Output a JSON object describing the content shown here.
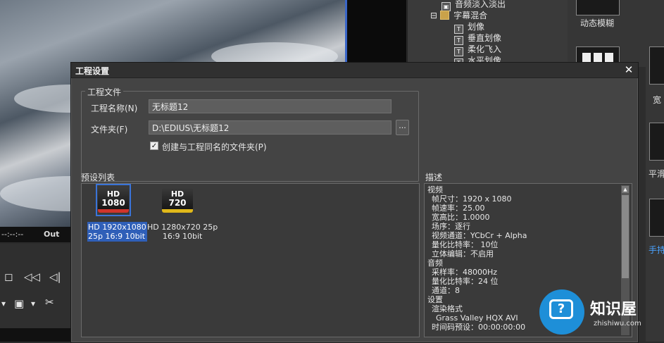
{
  "background": {
    "timecode_text": "--:--:--",
    "out_label": "Out",
    "transport_icons": [
      "stop-icon",
      "rewind-icon",
      "step-back-icon"
    ],
    "toolbar_icons": [
      "save-icon",
      "scissors-icon"
    ]
  },
  "tree": {
    "items": [
      {
        "label": "音频淡入淡出",
        "icon": "effect-icon",
        "level": 1
      },
      {
        "label": "字幕混合",
        "icon": "folder-icon",
        "level": 0
      },
      {
        "label": "划像",
        "icon": "title-icon",
        "level": 2
      },
      {
        "label": "垂直划像",
        "icon": "title-icon",
        "level": 2
      },
      {
        "label": "柔化飞入",
        "icon": "title-icon",
        "level": 2
      },
      {
        "label": "水平划像",
        "icon": "title-icon",
        "level": 2
      }
    ]
  },
  "thumbs": {
    "labels": [
      "动态模糊",
      "宽",
      "平滑",
      "手持"
    ]
  },
  "dialog": {
    "title": "工程设置",
    "close_symbol": "✕",
    "project_group": {
      "legend": "工程文件",
      "name_label": "工程名称(N)",
      "name_value": "无标题12",
      "folder_label": "文件夹(F)",
      "folder_value": "D:\\EDIUS\\无标题12",
      "browse_label": "...",
      "checkbox_label": "创建与工程同名的文件夹(P)",
      "checkbox_checked": true
    },
    "preset_list": {
      "label": "预设列表",
      "presets": [
        {
          "icon_top": "HD",
          "icon_bottom": "1080",
          "line1": "HD 1920x1080",
          "line2": "25p 16:9 10bit",
          "selected": true,
          "accent": "#d0342c"
        },
        {
          "icon_top": "HD",
          "icon_bottom": "720",
          "line1": "HD 1280x720 25p",
          "line2": "16:9 10bit",
          "selected": false,
          "accent": "#e0b81a"
        }
      ]
    },
    "description": {
      "label": "描述",
      "lines": [
        "视频",
        "  帧尺寸：1920 x 1080",
        "  帧速率：25.00",
        "  宽高比：1.0000",
        "  场序：逐行",
        "  视频通道：YCbCr + Alpha",
        "  量化比特率： 10位",
        "  立体编辑：不启用",
        "音频",
        "  采样率：48000Hz",
        "  量化比特率：24 位",
        "  通道：8",
        "设置",
        "  渲染格式",
        "    Grass Valley HQX AVI",
        "  时间码预设：00:00:00:00"
      ]
    }
  },
  "watermark": {
    "title": "知识屋",
    "subtitle": "zhishiwu.com",
    "icon": "question-bubble-icon"
  }
}
